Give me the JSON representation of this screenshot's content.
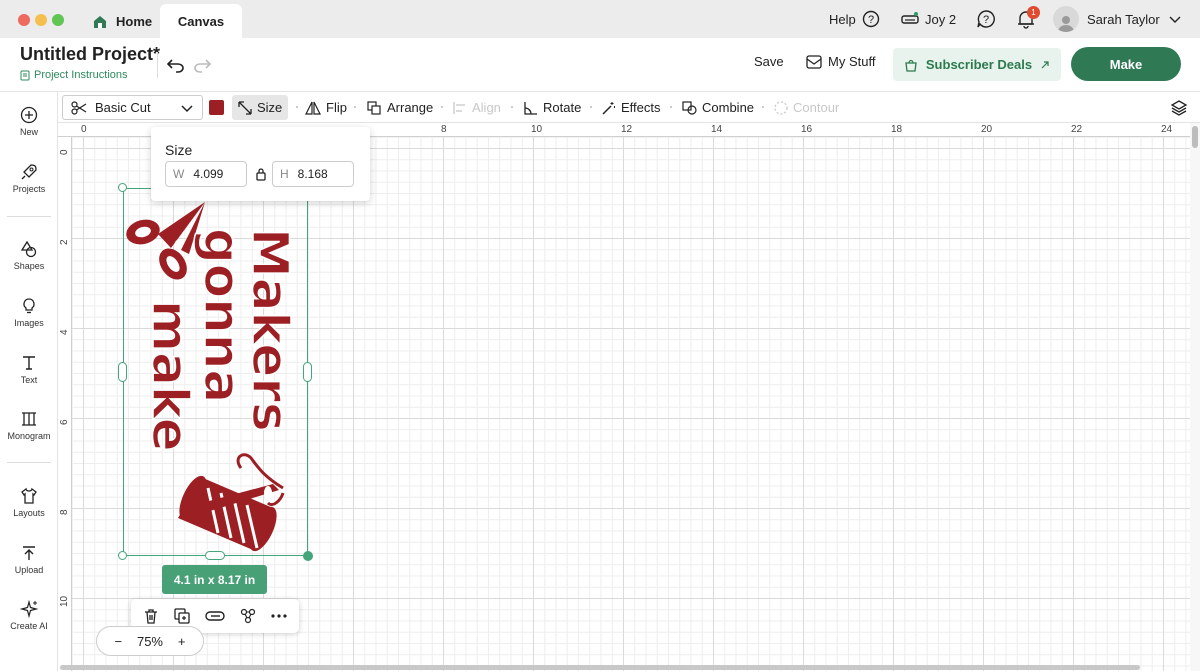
{
  "window": {
    "tabs": {
      "home_label": "Home",
      "canvas_label": "Canvas"
    },
    "help_label": "Help",
    "machine_label": "Joy 2",
    "notification_count": "1",
    "user_name": "Sarah Taylor"
  },
  "header": {
    "project_title": "Untitled Project*",
    "project_instructions": "Project Instructions",
    "save_label": "Save",
    "my_stuff_label": "My Stuff",
    "subscriber_deals_label": "Subscriber Deals",
    "make_label": "Make"
  },
  "left_toolbar": {
    "items": [
      {
        "label": "New",
        "icon": "plus-circle-icon"
      },
      {
        "label": "Projects",
        "icon": "rocket-icon"
      },
      {
        "label": "Shapes",
        "icon": "shapes-icon"
      },
      {
        "label": "Images",
        "icon": "lightbulb-icon"
      },
      {
        "label": "Text",
        "icon": "text-icon"
      },
      {
        "label": "Monogram",
        "icon": "monogram-icon"
      },
      {
        "label": "Layouts",
        "icon": "tshirt-icon"
      },
      {
        "label": "Upload",
        "icon": "upload-icon"
      },
      {
        "label": "Create AI",
        "icon": "sparkle-icon"
      }
    ]
  },
  "edit_toolbar": {
    "operation": "Basic Cut",
    "color": "#9c1f24",
    "size_label": "Size",
    "flip_label": "Flip",
    "arrange_label": "Arrange",
    "align_label": "Align",
    "rotate_label": "Rotate",
    "effects_label": "Effects",
    "combine_label": "Combine",
    "contour_label": "Contour"
  },
  "rulers": {
    "top": [
      "0",
      "8",
      "10",
      "12",
      "14",
      "16",
      "18",
      "20",
      "22",
      "24"
    ],
    "left": [
      "0",
      "2",
      "4",
      "6",
      "8",
      "10"
    ]
  },
  "size_popup": {
    "title": "Size",
    "w_label": "W",
    "w_value": "4.099",
    "h_label": "H",
    "h_value": "8.168"
  },
  "design": {
    "words": [
      "Makers",
      "gonna",
      "make"
    ],
    "color": "#9c1f24"
  },
  "selection": {
    "dimensions": "4.1  in x 8.17  in"
  },
  "context_actions": [
    "trash-icon",
    "duplicate-icon",
    "attach-icon",
    "group-icon",
    "more-icon"
  ],
  "zoom": {
    "minus": "−",
    "value": "75%",
    "plus": "+"
  }
}
